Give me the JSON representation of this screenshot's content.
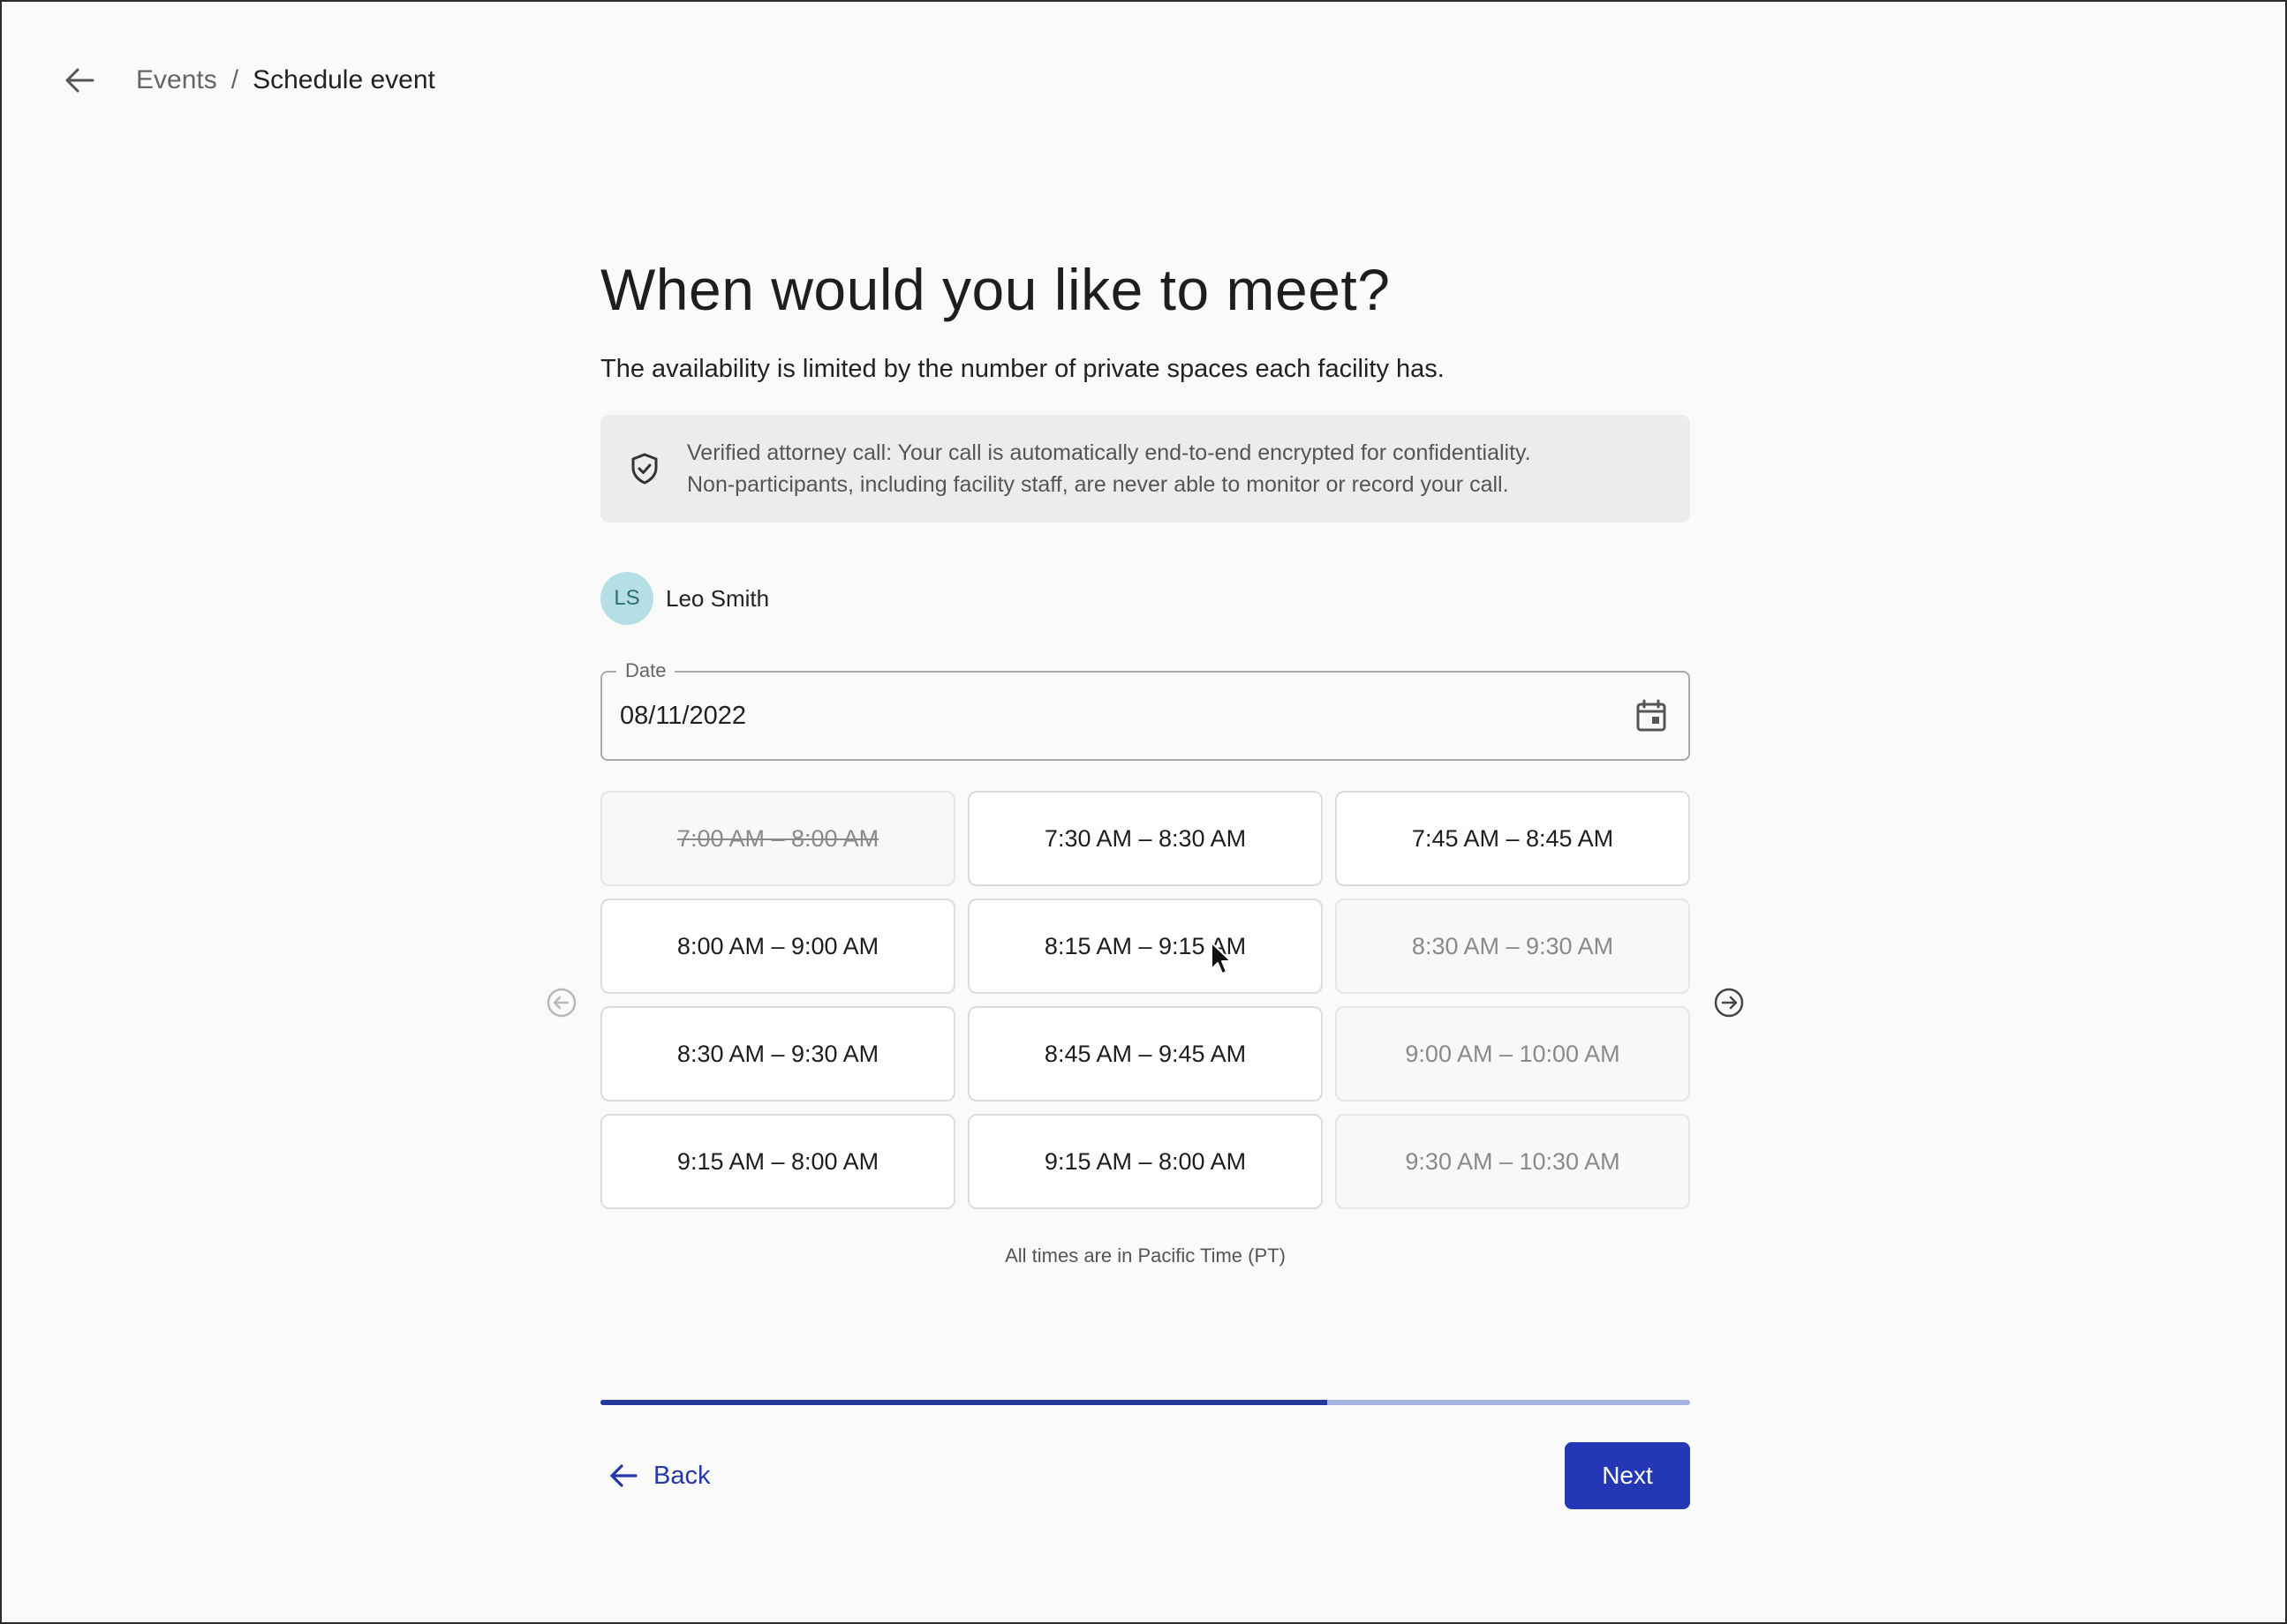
{
  "breadcrumb": {
    "parent": "Events",
    "separator": "/",
    "current": "Schedule event"
  },
  "page": {
    "title": "When would you like to meet?",
    "subtitle": "The availability is limited by the number of private spaces each facility has."
  },
  "notice": {
    "icon": "shield-check-icon",
    "line1": "Verified attorney call: Your call is automatically end-to-end encrypted for confidentiality.",
    "line2": "Non-participants, including facility staff, are never able to monitor or record your call."
  },
  "person": {
    "initials": "LS",
    "name": "Leo Smith"
  },
  "date_field": {
    "label": "Date",
    "value": "08/11/2022",
    "icon": "calendar-icon"
  },
  "slots": [
    {
      "label": "7:00 AM – 8:00 AM",
      "state": "unavailable"
    },
    {
      "label": "7:30 AM – 8:30 AM",
      "state": "available"
    },
    {
      "label": "7:45 AM – 8:45 AM",
      "state": "available"
    },
    {
      "label": "8:00 AM – 9:00 AM",
      "state": "available"
    },
    {
      "label": "8:15 AM – 9:15 AM",
      "state": "available"
    },
    {
      "label": "8:30 AM – 9:30 AM",
      "state": "disabled"
    },
    {
      "label": "8:30 AM – 9:30 AM",
      "state": "available"
    },
    {
      "label": "8:45 AM – 9:45 AM",
      "state": "available"
    },
    {
      "label": "9:00 AM – 10:00 AM",
      "state": "disabled"
    },
    {
      "label": "9:15 AM – 8:00 AM",
      "state": "available"
    },
    {
      "label": "9:15 AM – 8:00 AM",
      "state": "available"
    },
    {
      "label": "9:30 AM – 10:30 AM",
      "state": "disabled"
    }
  ],
  "timezone_note": "All times are in Pacific Time (PT)",
  "progress": {
    "fraction": 0.667
  },
  "footer": {
    "back_label": "Back",
    "next_label": "Next"
  },
  "colors": {
    "primary": "#2438b5",
    "progress_fill": "#243a9a",
    "progress_track": "#a7b1dd",
    "avatar_bg": "#b6dfe5",
    "notice_bg": "#ececec"
  }
}
